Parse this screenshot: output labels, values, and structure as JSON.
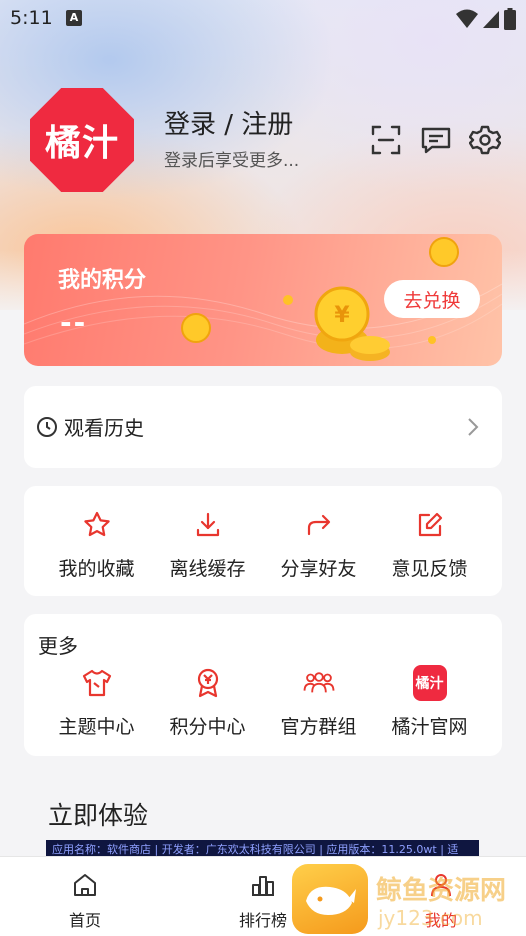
{
  "status_bar": {
    "time": "5:11",
    "notification_letter": "A"
  },
  "profile": {
    "logo_text": "橘汁",
    "login_title": "登录 / 注册",
    "login_subtitle": "登录后享受更多...",
    "icons": [
      "scan-icon",
      "message-icon",
      "settings-icon"
    ]
  },
  "points": {
    "label": "我的积分",
    "value": "--",
    "exchange_button": "去兑换"
  },
  "history": {
    "label": "观看历史"
  },
  "shortcuts": [
    {
      "label": "我的收藏",
      "icon": "star-icon"
    },
    {
      "label": "离线缓存",
      "icon": "download-icon"
    },
    {
      "label": "分享好友",
      "icon": "share-icon"
    },
    {
      "label": "意见反馈",
      "icon": "feedback-edit-icon"
    }
  ],
  "more": {
    "title": "更多",
    "items": [
      {
        "label": "主题中心",
        "icon": "tshirt-icon"
      },
      {
        "label": "积分中心",
        "icon": "yuan-medal-icon"
      },
      {
        "label": "官方群组",
        "icon": "group-icon"
      },
      {
        "label": "橘汁官网",
        "icon": "juzhi-logo-icon",
        "icon_text": "橘汁"
      }
    ]
  },
  "try_now": {
    "title": "立即体验",
    "banner_text": "应用名称：软件商店 | 开发者：广东欢太科技有限公司 | 应用版本：11.25.0wt | 适"
  },
  "bottom_nav": [
    {
      "label": "首页",
      "icon": "home-icon",
      "active": false
    },
    {
      "label": "排行榜",
      "icon": "ranking-icon",
      "active": false
    },
    {
      "label": "我的",
      "icon": "profile-icon",
      "active": true
    }
  ],
  "watermark": {
    "text": "鲸鱼资源网",
    "url": "jy123.com"
  },
  "colors": {
    "brand_red": "#ef2a40",
    "accent_red": "#e8362e",
    "points_gradient_start": "#ff7a6e",
    "points_gradient_end": "#ffc3a8"
  }
}
